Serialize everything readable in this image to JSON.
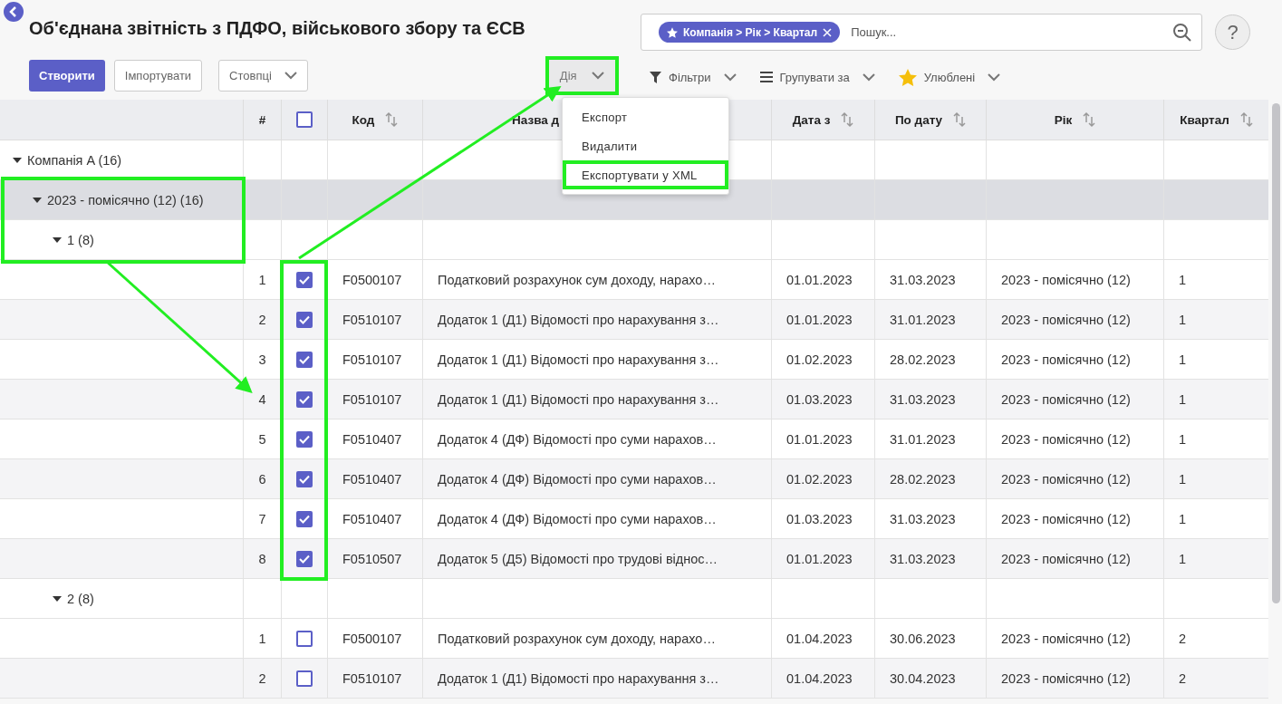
{
  "title": "Об'єднана звітність з ПДФО, військового збору та ЄСВ",
  "buttons": {
    "create": "Створити",
    "import": "Імпортувати",
    "columns": "Стовпці",
    "action": "Дія"
  },
  "search": {
    "facet": "Компанія > Рік > Квартал",
    "placeholder": "Пошук..."
  },
  "help": "?",
  "toolbar": [
    {
      "kind": "filter",
      "label": "Фільтри"
    },
    {
      "kind": "group",
      "label": "Групувати за"
    },
    {
      "kind": "favorite",
      "label": "Улюблені"
    }
  ],
  "action_menu": {
    "open": true,
    "items": [
      {
        "label": "Експорт",
        "highlighted": false
      },
      {
        "label": "Видалити",
        "highlighted": false
      },
      {
        "label": "Експортувати у XML",
        "highlighted": true
      }
    ]
  },
  "table": {
    "columns": [
      {
        "label": "#",
        "sortable": false
      },
      {
        "label": "Код",
        "sortable": true
      },
      {
        "label": "Назва д",
        "sortable": false
      },
      {
        "label": "Дата з",
        "sortable": true
      },
      {
        "label": "По дату",
        "sortable": true
      },
      {
        "label": "Рік",
        "sortable": true
      },
      {
        "label": "Квартал",
        "sortable": true
      }
    ],
    "select_all_checked": false,
    "groups": [
      {
        "label": "Компанія A (16)",
        "expanded": true,
        "children": [
          {
            "label": "2023 - помісячно (12) (16)",
            "expanded": true,
            "children": [
              {
                "label": "1 (8)",
                "expanded": true,
                "records": [
                  {
                    "num": "1",
                    "checked": true,
                    "code": "F0500107",
                    "name": "Податковий розрахунок сум доходу, нарахо…",
                    "date_from": "01.01.2023",
                    "date_to": "31.03.2023",
                    "year": "2023 - помісячно (12)",
                    "quarter": "1"
                  },
                  {
                    "num": "2",
                    "checked": true,
                    "code": "F0510107",
                    "name": "Додаток 1 (Д1) Відомості про нарахування з…",
                    "date_from": "01.01.2023",
                    "date_to": "31.01.2023",
                    "year": "2023 - помісячно (12)",
                    "quarter": "1"
                  },
                  {
                    "num": "3",
                    "checked": true,
                    "code": "F0510107",
                    "name": "Додаток 1 (Д1) Відомості про нарахування з…",
                    "date_from": "01.02.2023",
                    "date_to": "28.02.2023",
                    "year": "2023 - помісячно (12)",
                    "quarter": "1"
                  },
                  {
                    "num": "4",
                    "checked": true,
                    "code": "F0510107",
                    "name": "Додаток 1 (Д1) Відомості про нарахування з…",
                    "date_from": "01.03.2023",
                    "date_to": "31.03.2023",
                    "year": "2023 - помісячно (12)",
                    "quarter": "1"
                  },
                  {
                    "num": "5",
                    "checked": true,
                    "code": "F0510407",
                    "name": "Додаток 4 (ДФ) Відомості про суми нарахов…",
                    "date_from": "01.01.2023",
                    "date_to": "31.01.2023",
                    "year": "2023 - помісячно (12)",
                    "quarter": "1"
                  },
                  {
                    "num": "6",
                    "checked": true,
                    "code": "F0510407",
                    "name": "Додаток 4 (ДФ) Відомості про суми нарахов…",
                    "date_from": "01.02.2023",
                    "date_to": "28.02.2023",
                    "year": "2023 - помісячно (12)",
                    "quarter": "1"
                  },
                  {
                    "num": "7",
                    "checked": true,
                    "code": "F0510407",
                    "name": "Додаток 4 (ДФ) Відомості про суми нарахов…",
                    "date_from": "01.03.2023",
                    "date_to": "31.03.2023",
                    "year": "2023 - помісячно (12)",
                    "quarter": "1"
                  },
                  {
                    "num": "8",
                    "checked": true,
                    "code": "F0510507",
                    "name": "Додаток 5 (Д5) Відомості про трудові віднос…",
                    "date_from": "01.01.2023",
                    "date_to": "31.03.2023",
                    "year": "2023 - помісячно (12)",
                    "quarter": "1"
                  }
                ]
              },
              {
                "label": "2 (8)",
                "expanded": true,
                "records": [
                  {
                    "num": "1",
                    "checked": false,
                    "code": "F0500107",
                    "name": "Податковий розрахунок сум доходу, нарахо…",
                    "date_from": "01.04.2023",
                    "date_to": "30.06.2023",
                    "year": "2023 - помісячно (12)",
                    "quarter": "2"
                  },
                  {
                    "num": "2",
                    "checked": false,
                    "code": "F0510107",
                    "name": "Додаток 1 (Д1) Відомості про нарахування з…",
                    "date_from": "01.04.2023",
                    "date_to": "30.04.2023",
                    "year": "2023 - помісячно (12)",
                    "quarter": "2"
                  }
                ]
              }
            ]
          }
        ]
      }
    ]
  }
}
